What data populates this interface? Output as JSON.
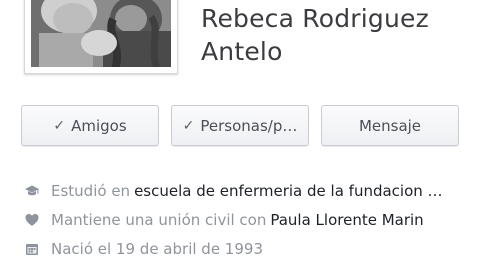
{
  "profile": {
    "name": "Rebeca Rodriguez Antelo"
  },
  "actions": {
    "friends_label": "Amigos",
    "people_label": "Personas/p…",
    "message_label": "Mensaje"
  },
  "info": {
    "education_prefix": "Estudió en",
    "education_value": "escuela de enfermeria de la fundacion …",
    "relationship_prefix": "Mantiene una unión civil con",
    "relationship_value": "Paula Llorente Marin",
    "birthday_text": "Nació el 19 de abril de 1993"
  },
  "icons": {
    "check": "check-icon",
    "education": "graduation-cap-icon",
    "relationship": "heart-icon",
    "birthday": "calendar-icon"
  },
  "colors": {
    "button_text": "#4b4f56",
    "muted_text": "#90949c",
    "strong_text": "#1d2129",
    "icon": "#8d949e"
  }
}
